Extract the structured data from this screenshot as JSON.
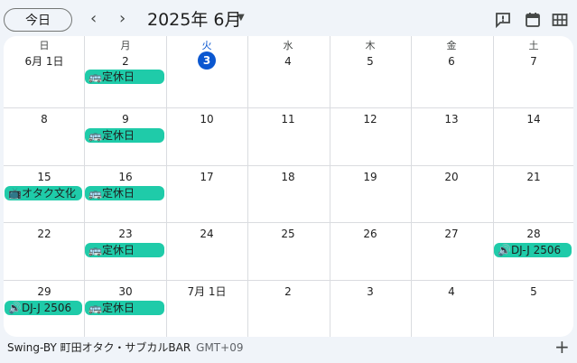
{
  "toolbar": {
    "today_label": "今日",
    "prev_icon": "‹",
    "next_icon": "›",
    "month_title": "2025年 6月",
    "caret": "▼",
    "icons": [
      "feedback-icon",
      "calendar-icon",
      "grid-icon"
    ]
  },
  "weekdays": [
    "日",
    "月",
    "火",
    "水",
    "木",
    "金",
    "土"
  ],
  "weeks": [
    [
      "6月 1日",
      "2",
      "3",
      "4",
      "5",
      "6",
      "7"
    ],
    [
      "8",
      "9",
      "10",
      "11",
      "12",
      "13",
      "14"
    ],
    [
      "15",
      "16",
      "17",
      "18",
      "19",
      "20",
      "21"
    ],
    [
      "22",
      "23",
      "24",
      "25",
      "26",
      "27",
      "28"
    ],
    [
      "29",
      "30",
      "7月 1日",
      "2",
      "3",
      "4",
      "5"
    ]
  ],
  "today": "3",
  "events": {
    "closed": "🚌定休日",
    "otaku": "📺オタク文化",
    "dj": "🔊DJ-J 2506"
  },
  "footer": {
    "calendar_name": "Swing-BY 町田オタク・サブカルBAR",
    "timezone": "GMT+09",
    "plus": "+"
  },
  "colors": {
    "event": "#1fcba9",
    "today": "#0b57d0",
    "background": "#f0f4f9"
  }
}
